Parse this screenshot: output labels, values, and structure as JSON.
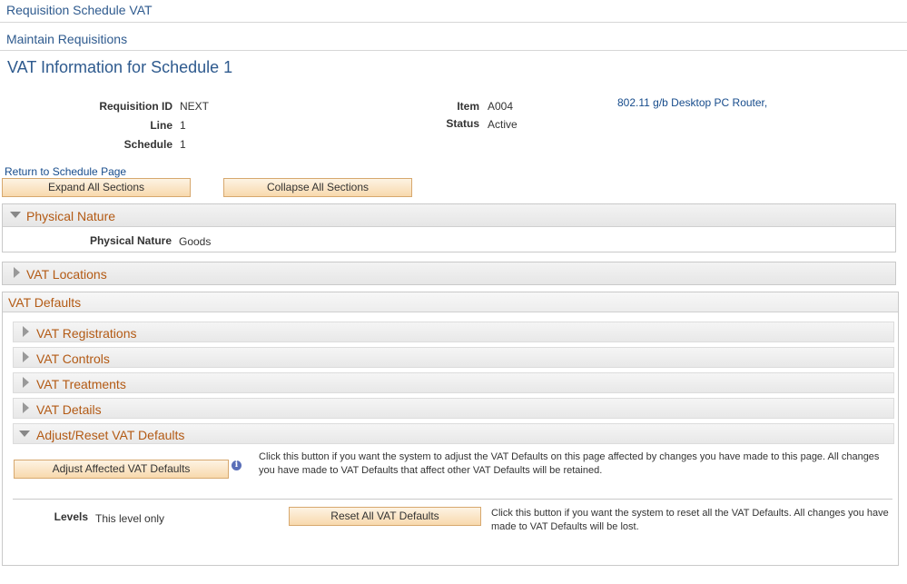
{
  "header": {
    "component_title": "Requisition Schedule VAT",
    "nav_title": "Maintain Requisitions",
    "page_title": "VAT Information for Schedule 1"
  },
  "fields": {
    "requisition_id_label": "Requisition ID",
    "requisition_id_value": "NEXT",
    "line_label": "Line",
    "line_value": "1",
    "schedule_label": "Schedule",
    "schedule_value": "1",
    "item_label": "Item",
    "item_value": "A004",
    "item_description": "802.11 g/b Desktop PC Router,",
    "status_label": "Status",
    "status_value": "Active"
  },
  "actions": {
    "return_link": "Return to Schedule Page",
    "expand_all": "Expand All Sections",
    "collapse_all": "Collapse All Sections"
  },
  "physical_nature": {
    "title": "Physical Nature",
    "label": "Physical Nature",
    "value": "Goods"
  },
  "vat_locations": {
    "title": "VAT Locations"
  },
  "vat_defaults": {
    "title": "VAT Defaults",
    "subsections": [
      {
        "label": "VAT Registrations",
        "expanded": false
      },
      {
        "label": "VAT Controls",
        "expanded": false
      },
      {
        "label": "VAT Treatments",
        "expanded": false
      },
      {
        "label": "VAT Details",
        "expanded": false
      },
      {
        "label": "Adjust/Reset VAT Defaults",
        "expanded": true
      }
    ],
    "adjust_button": "Adjust Affected VAT Defaults",
    "adjust_help": "Click this button if you want the system to adjust the VAT Defaults on this page affected by changes you have made to this page. All changes you have made to VAT Defaults that affect other VAT Defaults will be retained.",
    "levels_label": "Levels",
    "levels_value": "This level only",
    "reset_button": "Reset All VAT Defaults",
    "reset_help": "Click this button if you want the system to reset all the VAT Defaults. All changes you have made to VAT Defaults will be lost."
  },
  "icons": {
    "collapsed": "triangle-right-icon",
    "expanded": "triangle-down-icon",
    "info": "info-icon"
  },
  "colors": {
    "title_blue": "#2e5a8e",
    "section_orange": "#b35a14",
    "link_blue": "#174c8c",
    "button_fill": "#f8d9ad"
  }
}
